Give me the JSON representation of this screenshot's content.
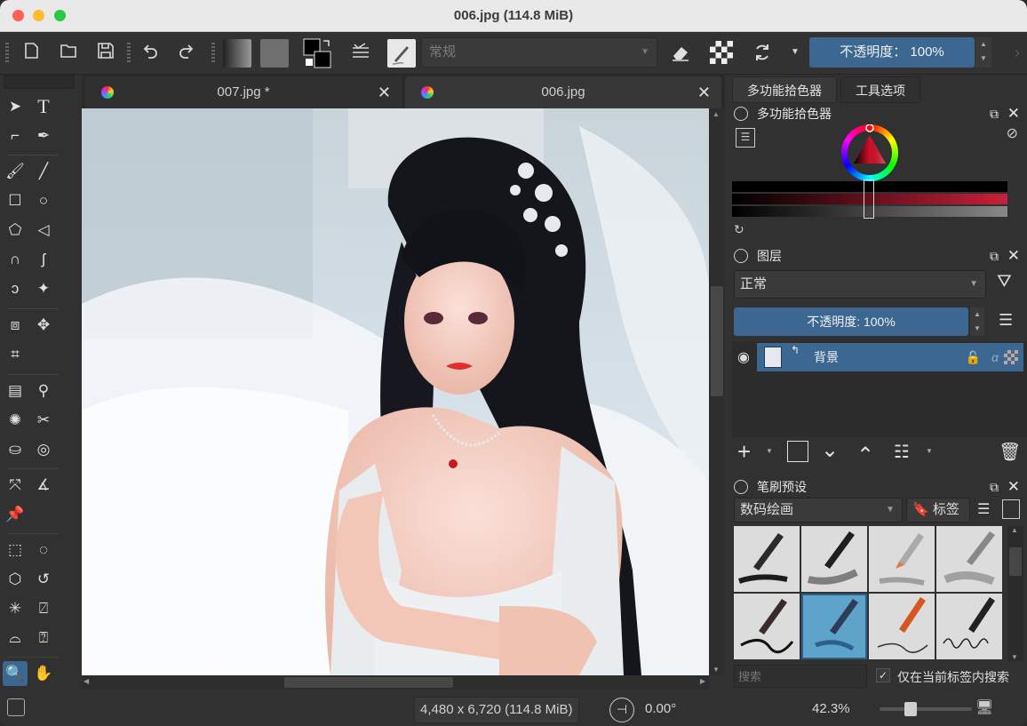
{
  "window": {
    "title": "006.jpg (114.8 MiB)"
  },
  "toolbar": {
    "icons": [
      "new-document-icon",
      "open-folder-icon",
      "save-icon",
      "undo-icon",
      "redo-icon",
      "gradient-swatch-icon",
      "pattern-swatch-icon",
      "fg-bg-color-icon",
      "brush-settings-icon",
      "brush-preset-icon",
      "eraser-icon",
      "alpha-lock-icon",
      "reload-icon",
      "chevron-down-icon"
    ],
    "blend_mode": "常规",
    "opacity": "不透明度： 100%"
  },
  "tabs": [
    {
      "label": "007.jpg *",
      "active": false
    },
    {
      "label": "006.jpg",
      "active": true
    }
  ],
  "dock": {
    "tabs": [
      "多功能拾色器",
      "工具选项"
    ],
    "color_panel": {
      "title": "多功能拾色器"
    },
    "layers_panel": {
      "title": "图层",
      "blend_mode": "正常",
      "opacity": "不透明度: 100%",
      "layer_name": "背景"
    },
    "brush_panel": {
      "title": "笔刷预设",
      "category": "数码绘画",
      "tag_label": "标签",
      "search_placeholder": "搜索",
      "filter_label": "仅在当前标签内搜索"
    }
  },
  "status": {
    "dimensions": "4,480 x 6,720 (114.8 MiB)",
    "rotation": "0.00°",
    "zoom": "42.3%"
  },
  "colors": {
    "accent": "#3c6791",
    "bg": "#313131"
  }
}
